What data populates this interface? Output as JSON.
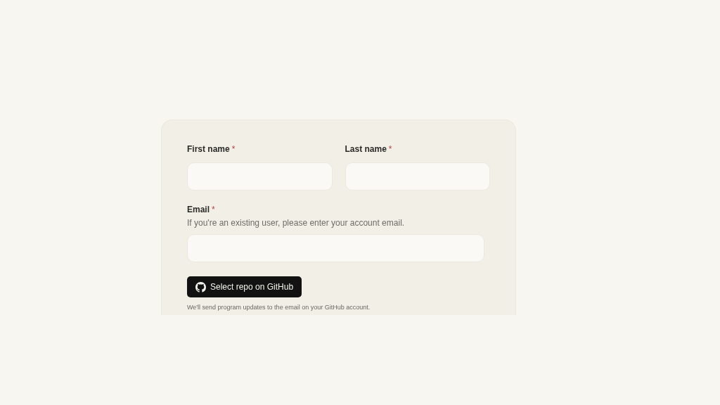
{
  "form": {
    "name_fields": [
      {
        "label": "First name",
        "required_mark": "*"
      },
      {
        "label": "Last name",
        "required_mark": "*"
      }
    ],
    "email_field": {
      "label": "Email",
      "required_mark": "*",
      "hint": "If you're an existing user, please enter your account email."
    },
    "github_button": {
      "label": "Select repo on GitHub"
    },
    "note": "We'll send program updates to the email on your GitHub account."
  }
}
